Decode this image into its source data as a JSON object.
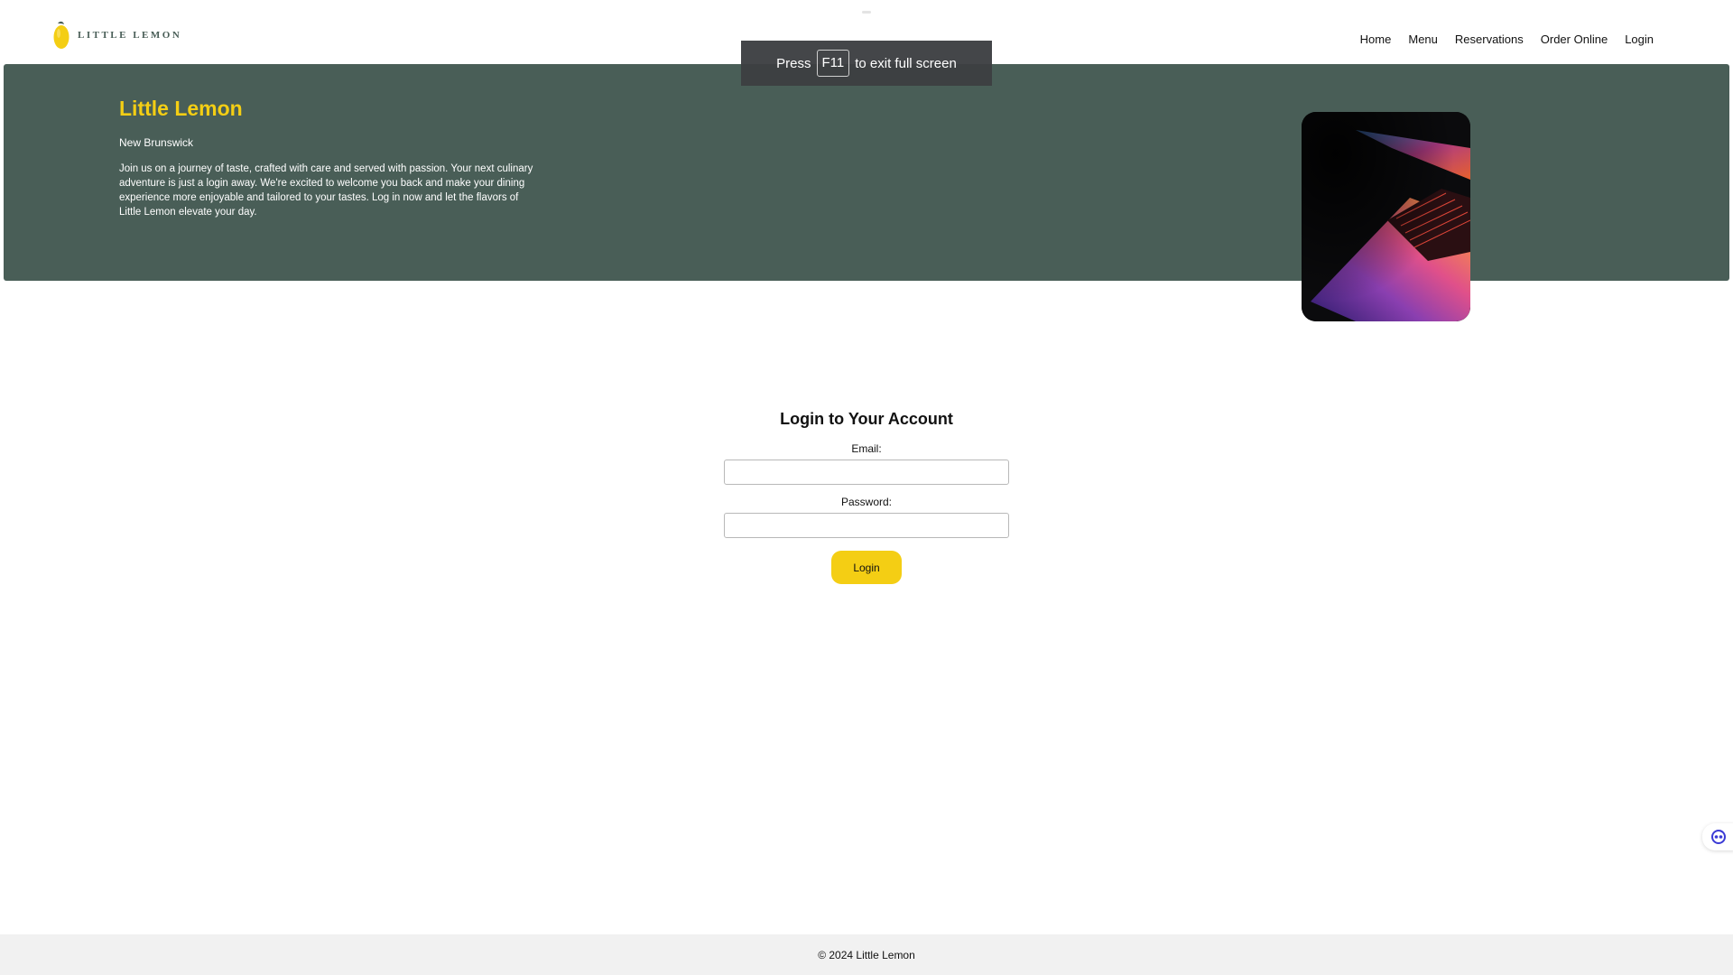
{
  "header": {
    "logo_text": "Little Lemon",
    "nav": [
      "Home",
      "Menu",
      "Reservations",
      "Order Online",
      "Login"
    ]
  },
  "fullscreen_notice": {
    "prefix": "Press",
    "key": "F11",
    "suffix": "to exit full screen"
  },
  "hero": {
    "title": "Little Lemon",
    "subtitle": "New Brunswick",
    "description": "Join us on a journey of taste, crafted with care and served with passion. Your next culinary adventure is just a login away. We're excited to welcome you back and make your dining experience more enjoyable and tailored to your tastes. Log in now and let the flavors of Little Lemon elevate your day."
  },
  "login": {
    "heading": "Login to Your Account",
    "email_label": "Email:",
    "email_value": "",
    "password_label": "Password:",
    "password_value": "",
    "button_label": "Login"
  },
  "footer": {
    "text": "© 2024 Little Lemon"
  },
  "colors": {
    "brand_green": "#495e57",
    "brand_yellow": "#f4ce14",
    "footer_bg": "#f1f1f1"
  },
  "icons": {
    "logo": "lemon-icon",
    "floating": "assistant-face-icon"
  }
}
